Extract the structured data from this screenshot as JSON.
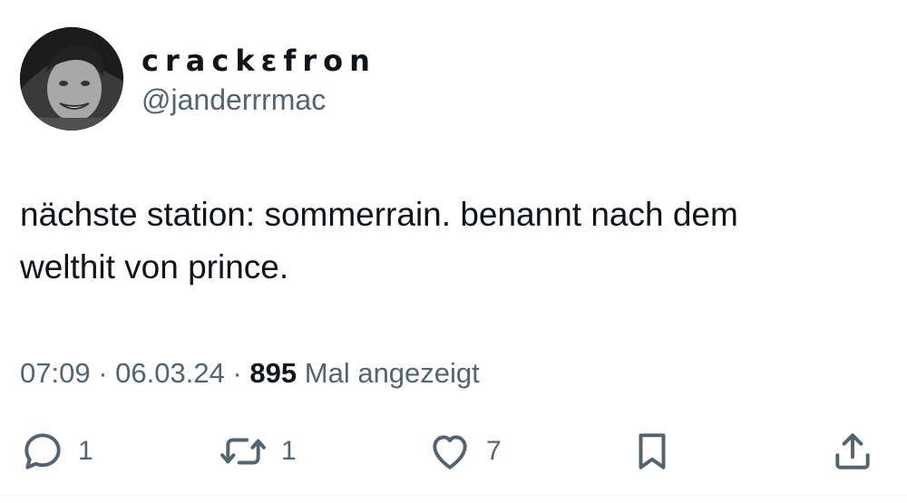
{
  "user": {
    "display_name": "crackεfron",
    "handle": "@janderrrmac"
  },
  "tweet": {
    "text_line1": "nächste station: sommerrain. benannt nach dem",
    "text_line2": "welthit von prince."
  },
  "meta": {
    "time": "07:09",
    "sep1": "·",
    "date": "06.03.24",
    "sep2": "·",
    "views_count": "895",
    "views_label": "Mal angezeigt"
  },
  "actions": {
    "reply": {
      "icon": "reply-icon",
      "count": "1"
    },
    "repost": {
      "icon": "repost-icon",
      "count": "1"
    },
    "like": {
      "icon": "heart-icon",
      "count": "7"
    },
    "bookmark": {
      "icon": "bookmark-icon"
    },
    "share": {
      "icon": "share-icon"
    }
  },
  "colors": {
    "text": "#0f1419",
    "secondary": "#536471",
    "background": "#ffffff"
  }
}
